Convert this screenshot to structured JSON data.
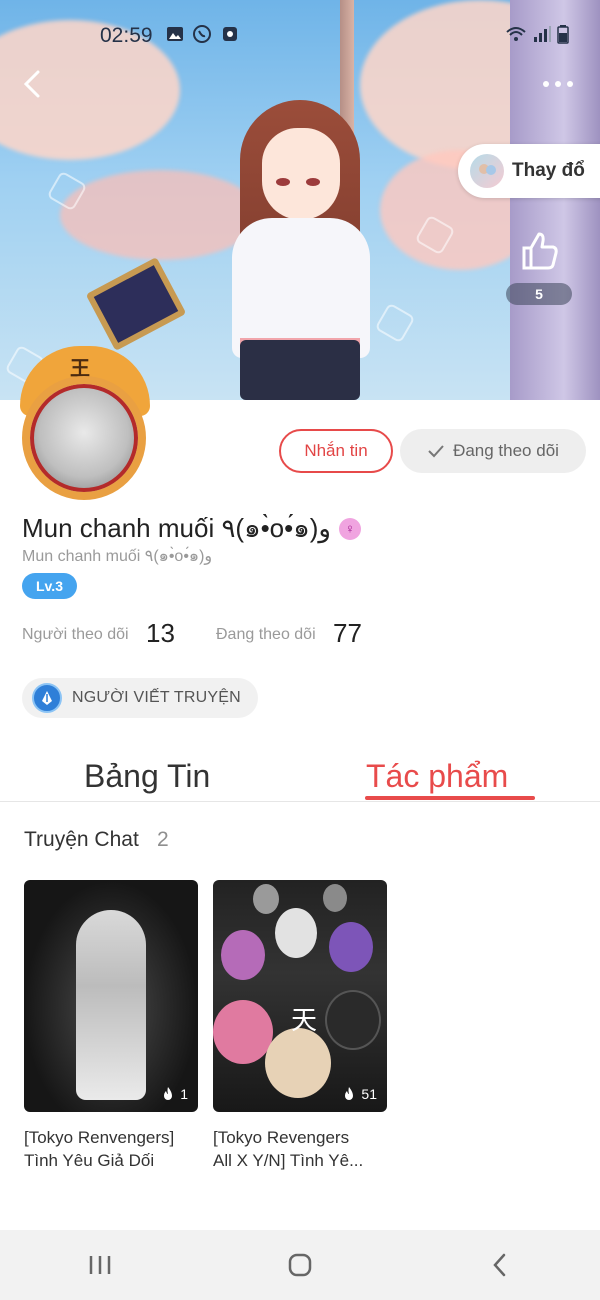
{
  "status_bar": {
    "time": "02:59",
    "left_icons": [
      "image-icon",
      "viber-icon",
      "app-icon"
    ],
    "right_icons": [
      "wifi-icon",
      "signal-icon",
      "battery-icon"
    ]
  },
  "cover": {
    "change_label": "Thay đổ",
    "like_count": "5"
  },
  "profile": {
    "display_name": "Mun chanh muối ٩(๑•̀o•́๑)و",
    "username": "Mun chanh muối ٩(๑•̀o•́๑)و",
    "gender_symbol": "♀",
    "level": "Lv.3",
    "message_button": "Nhắn tin",
    "following_button": "Đang theo dõi",
    "followers_label": "Người theo dõi",
    "followers_count": "13",
    "following_label": "Đang theo dõi",
    "following_count": "77",
    "badge_label": "NGƯỜI VIẾT TRUYỆN",
    "avatar_mark": "王"
  },
  "tabs": {
    "feed": "Bảng Tin",
    "works": "Tác phẩm",
    "active": "works"
  },
  "section": {
    "title": "Truyện Chat",
    "count": "2"
  },
  "stories": [
    {
      "title_line1": "[Tokyo Renvengers]",
      "title_line2": "Tình Yêu Giả Dối",
      "likes": "1"
    },
    {
      "title_line1": "[Tokyo Revengers",
      "title_line2": "All X Y/N] Tình Yê...",
      "likes": "51",
      "cover_text": "天"
    }
  ],
  "colors": {
    "accent": "#e84b4b",
    "level": "#45a4ef",
    "badge_icon": "#2f7fd8"
  }
}
